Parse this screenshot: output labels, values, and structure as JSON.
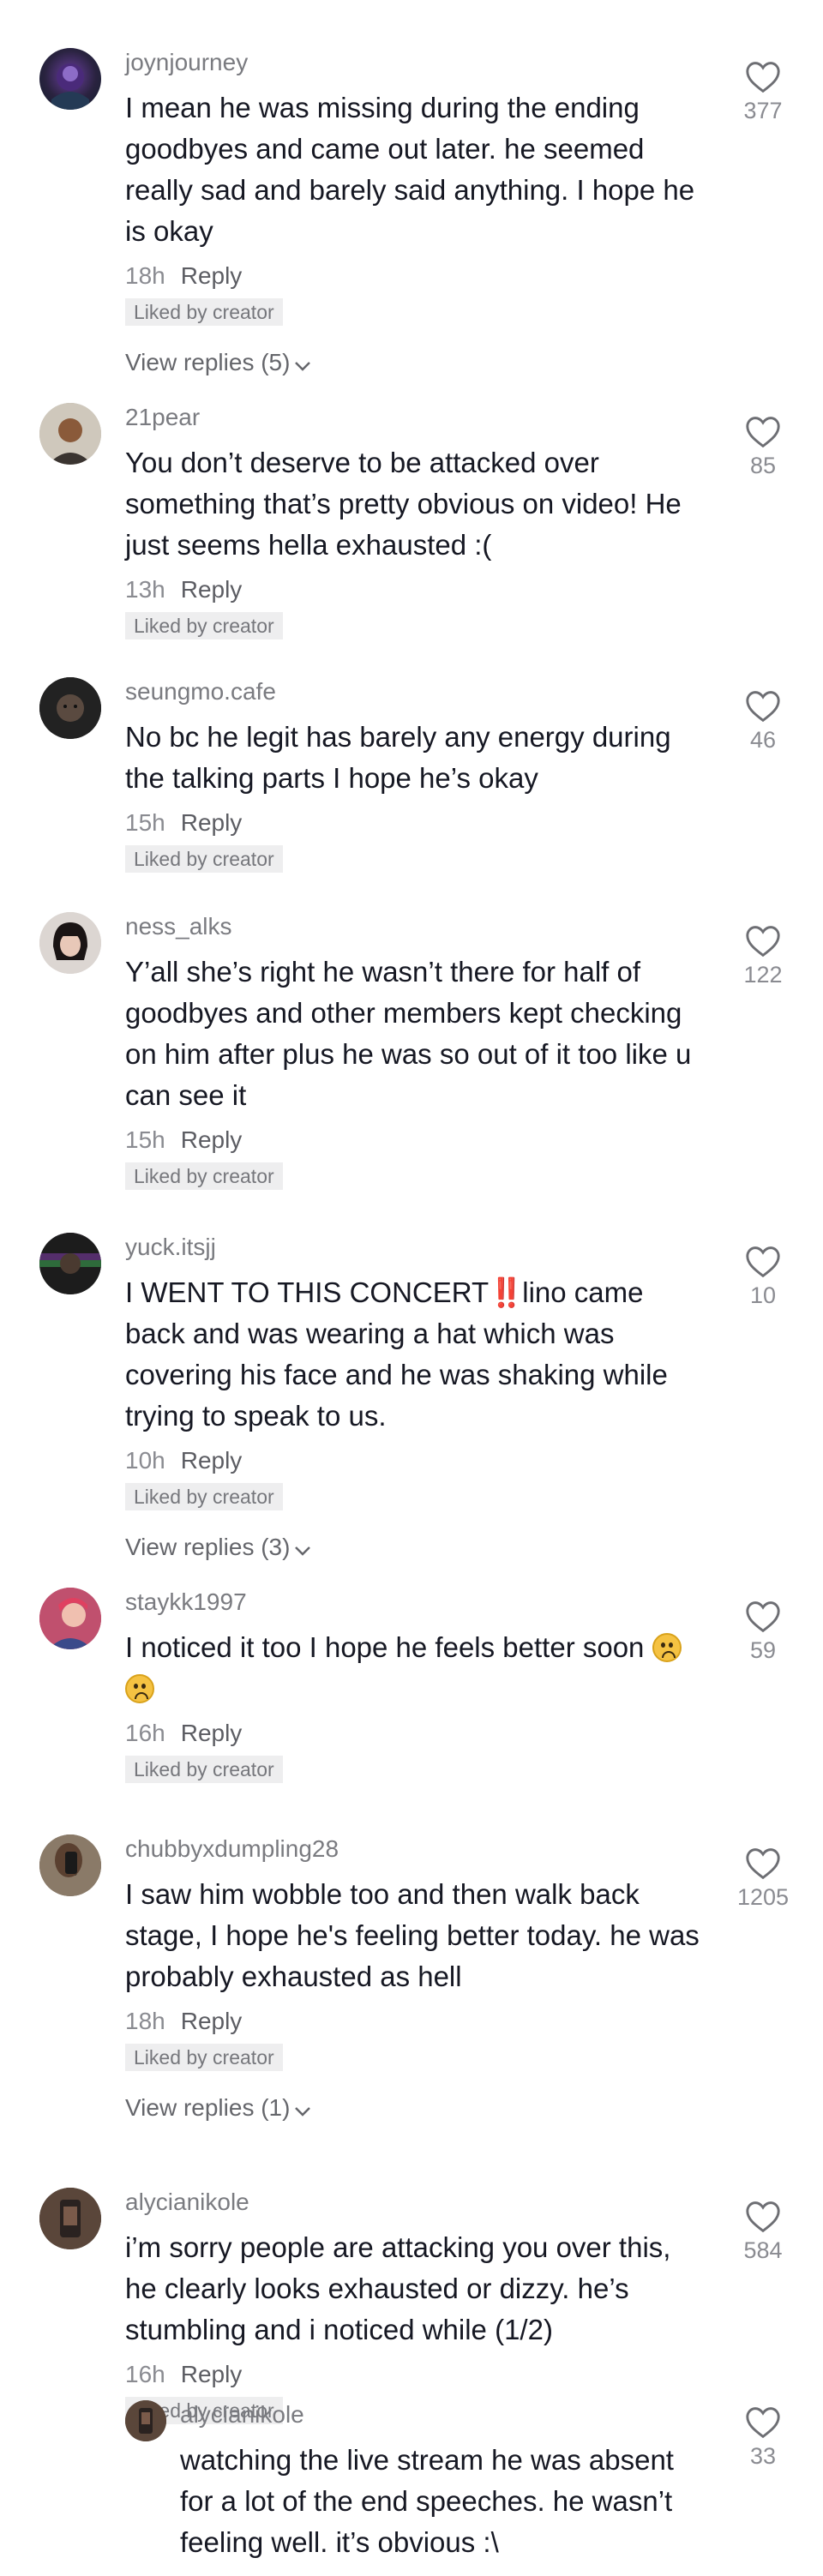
{
  "ui": {
    "reply_label": "Reply",
    "liked_by_creator": "Liked by creator",
    "colors": {
      "text": "#161823",
      "muted": "#8a8b91",
      "badge_bg": "#eeeeef",
      "accent_red": "#e0263a"
    }
  },
  "comments": [
    {
      "username": "joynjourney",
      "text": "I mean he was missing during the ending goodbyes and came out later. he seemed really sad and barely said anything. I hope he is okay",
      "time": "18h",
      "likes": "377",
      "view_replies": "View replies (5)"
    },
    {
      "username": "21pear",
      "text": "You don’t deserve to be attacked over something that’s pretty obvious on video! He just seems hella exhausted :(",
      "time": "13h",
      "likes": "85"
    },
    {
      "username": "seungmo.cafe",
      "text": "No bc he legit has barely any energy during the talking parts I hope he’s okay",
      "time": "15h",
      "likes": "46"
    },
    {
      "username": "ness_alks",
      "text": "Y’all she’s right he wasn’t there for half of goodbyes and other members kept checking on him after plus he was so out of it too like u can see it",
      "time": "15h",
      "likes": "122"
    },
    {
      "username": "yuck.itsjj",
      "text_before": "I WENT TO THIS CONCERT",
      "text_mark": "‼️",
      "text_after": "lino came back and was wearing a hat which was covering his face and he was shaking while trying to speak to us.",
      "time": "10h",
      "likes": "10",
      "view_replies": "View replies (3)"
    },
    {
      "username": "staykk1997",
      "text": "I noticed it too I hope he feels better soon",
      "time": "16h",
      "likes": "59"
    },
    {
      "username": "chubbyxdumpling28",
      "text": "I saw him wobble too and then walk back stage, I hope he's feeling better today. he was probably exhausted as hell",
      "time": "18h",
      "likes": "1205",
      "view_replies": "View replies (1)"
    },
    {
      "username": "alycianikole",
      "text": "i’m sorry people are attacking you over this, he clearly looks exhausted or dizzy. he’s stumbling and i noticed while (1/2)",
      "time": "16h",
      "likes": "584"
    }
  ],
  "reply": {
    "username": "alycianikole",
    "text": "watching the live stream he was absent for a lot of the end speeches. he wasn’t feeling well. it’s obvious :\\",
    "likes": "33"
  }
}
